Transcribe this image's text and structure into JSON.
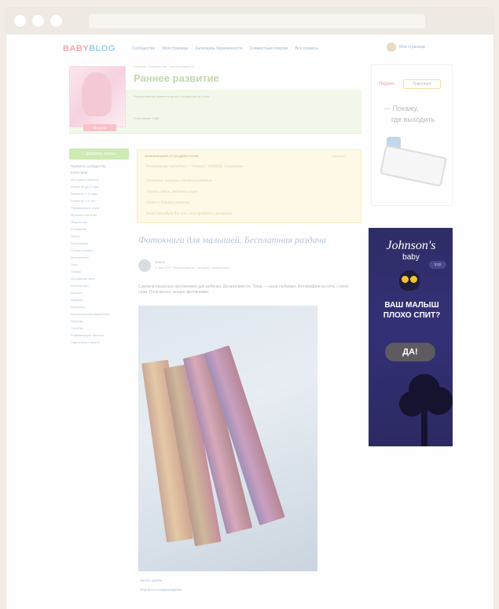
{
  "site": {
    "logo_left": "BABY",
    "logo_right": "BLOG",
    "nav": [
      "Сообщества",
      "Моя страница",
      "Календарь беременности",
      "Совместные покупки",
      "Все сервисы"
    ],
    "my_page": "Моя страница"
  },
  "community": {
    "breadcrumb": "Главная › Сообщества › Раннее развитие",
    "title": "Раннее развитие",
    "description": "Формирование развития детей с рождения до 6 лет",
    "join_label": "Вступить",
    "members": "Участников 7 566"
  },
  "sidebar": {
    "add_post": "+ Добавить запись",
    "links": [
      "Правила сообщества",
      "Категории"
    ],
    "items": [
      "Методики развития",
      "Развитие до 1 года",
      "Развитие 1-3 года",
      "Развитие 3-6 лет",
      "Развивающие игры",
      "Музыка и песенки",
      "Творчество",
      "Рисование",
      "Лепка",
      "Аппликация",
      "Чтение и книги",
      "Математика",
      "Речь",
      "Логика",
      "Английский язык",
      "Монтессори",
      "Домана",
      "Зайцева",
      "Никитины",
      "Вальдорфская педагогика",
      "Игрушки",
      "Пособия",
      "Развивающие занятия",
      "Подготовка к школе"
    ]
  },
  "moderators": {
    "heading": "ИНФОРМАЦИЯ ОТ МОДЕРАТОРОВ",
    "more": "Показать",
    "lines": [
      "Развивающие методики с \"Гомеры\", АПИОН. Справочник",
      "Отличные игрушки в Раннем развитии",
      "Сказки, стихи, задания и игры",
      "Обмен в Раннем развитии",
      "Ваши методики для всех, кто прибавил в развитии"
    ]
  },
  "post": {
    "title": "Фотокниги для малышей. Бесплатная раздача",
    "author": "Ольга",
    "meta": "21 мая 2015 · Раннее развитие · Методики · Комментарии",
    "text": "Сделала несколько фотокнижек для ребенка. Делали вместе. Тема — наша любимая. Фотографии из сети, с моих слов. Получилось четыре фотокнижки.",
    "read_more": "Читать далее",
    "comments": "Перейти к комментариям"
  },
  "yandex": {
    "logo": "Яндекс",
    "service": "Транспорт",
    "text_line1": "— Покажу,",
    "text_line2": "где выходить"
  },
  "ad": {
    "brand": "Johnson's",
    "sub": "baby",
    "time": "3:02",
    "headline": "ВАШ МАЛЫШ ПЛОХО СПИТ?",
    "button": "ДА!"
  }
}
